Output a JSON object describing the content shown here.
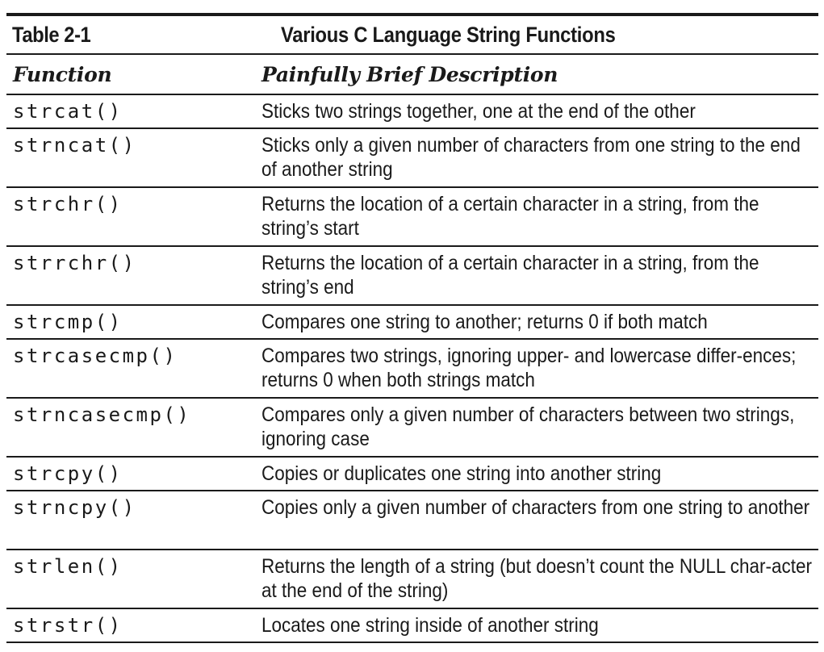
{
  "table": {
    "number": "Table 2-1",
    "title": "Various C Language String Functions",
    "headers": {
      "function": "Function",
      "description": "Painfully Brief Description"
    },
    "rows": [
      {
        "function": "strcat()",
        "description": "Sticks two strings together, one at the end of the other"
      },
      {
        "function": "strncat()",
        "description": "Sticks only a given number of characters from one string to the end of another string"
      },
      {
        "function": "strchr()",
        "description": "Returns the location of a certain character in a string, from the string’s start"
      },
      {
        "function": "strrchr()",
        "description": "Returns the location of a certain character in a string, from the string’s end"
      },
      {
        "function": "strcmp()",
        "description": "Compares one string to another; returns 0 if both match"
      },
      {
        "function": "strcasecmp()",
        "description": "Compares two strings, ignoring upper- and lowercase differ-ences; returns 0 when both strings match"
      },
      {
        "function": "strncasecmp()",
        "description": "Compares only a given number of characters between two strings, ignoring case"
      },
      {
        "function": "strcpy()",
        "description": "Copies or duplicates one string into another string"
      },
      {
        "function": "strncpy()",
        "description": "Copies only a given number of characters from one string to another"
      },
      {
        "function": "strlen()",
        "description": "Returns the length of a string (but doesn’t count the NULL char-acter at the end of the string)"
      },
      {
        "function": "strstr()",
        "description": "Locates one string inside of another string"
      }
    ]
  }
}
